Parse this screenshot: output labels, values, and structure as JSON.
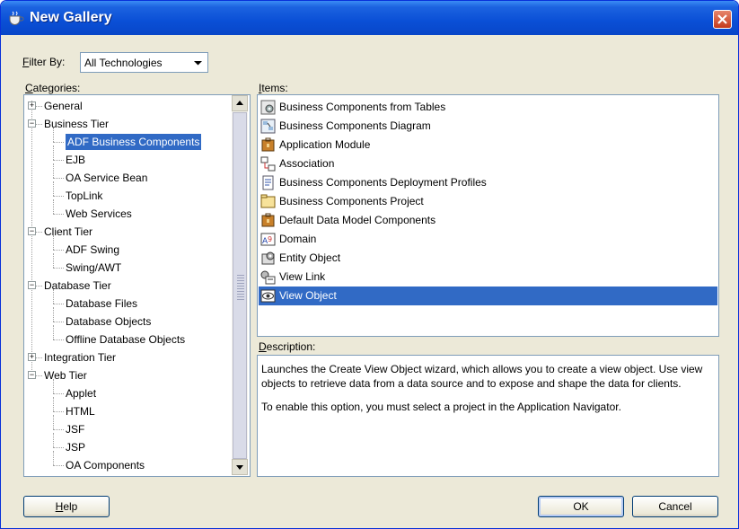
{
  "window": {
    "title": "New Gallery"
  },
  "filter": {
    "label_prefix": "F",
    "label_rest": "ilter By:",
    "value": "All Technologies"
  },
  "categories": {
    "label_prefix": "C",
    "label_rest": "ategories:",
    "tree": [
      {
        "label": "General",
        "level": 0,
        "expander": "plus"
      },
      {
        "label": "Business Tier",
        "level": 0,
        "expander": "minus"
      },
      {
        "label": "ADF Business Components",
        "level": 1,
        "selected": true
      },
      {
        "label": "EJB",
        "level": 1
      },
      {
        "label": "OA Service Bean",
        "level": 1
      },
      {
        "label": "TopLink",
        "level": 1
      },
      {
        "label": "Web Services",
        "level": 1
      },
      {
        "label": "Client Tier",
        "level": 0,
        "expander": "minus"
      },
      {
        "label": "ADF Swing",
        "level": 1
      },
      {
        "label": "Swing/AWT",
        "level": 1
      },
      {
        "label": "Database Tier",
        "level": 0,
        "expander": "minus"
      },
      {
        "label": "Database Files",
        "level": 1
      },
      {
        "label": "Database Objects",
        "level": 1
      },
      {
        "label": "Offline Database Objects",
        "level": 1
      },
      {
        "label": "Integration Tier",
        "level": 0,
        "expander": "plus"
      },
      {
        "label": "Web Tier",
        "level": 0,
        "expander": "minus"
      },
      {
        "label": "Applet",
        "level": 1
      },
      {
        "label": "HTML",
        "level": 1
      },
      {
        "label": "JSF",
        "level": 1
      },
      {
        "label": "JSP",
        "level": 1
      },
      {
        "label": "OA Components",
        "level": 1
      }
    ]
  },
  "items": {
    "label_prefix": "I",
    "label_rest": "tems:",
    "list": [
      {
        "label": "Business Components from Tables",
        "icon": "gear-table-icon"
      },
      {
        "label": "Business Components Diagram",
        "icon": "diagram-icon"
      },
      {
        "label": "Application Module",
        "icon": "module-icon"
      },
      {
        "label": "Association",
        "icon": "association-icon"
      },
      {
        "label": "Business Components Deployment Profiles",
        "icon": "deployment-profile-icon"
      },
      {
        "label": "Business Components Project",
        "icon": "project-icon"
      },
      {
        "label": "Default Data Model Components",
        "icon": "module-icon"
      },
      {
        "label": "Domain",
        "icon": "domain-icon"
      },
      {
        "label": "Entity Object",
        "icon": "entity-icon"
      },
      {
        "label": "View Link",
        "icon": "view-link-icon"
      },
      {
        "label": "View Object",
        "icon": "view-object-icon",
        "selected": true
      }
    ]
  },
  "description": {
    "label_prefix": "D",
    "label_rest": "escription:",
    "paragraphs": [
      "Launches the Create View Object wizard, which allows you to create a view object. Use view objects to retrieve data from a data source and to expose and shape the data for clients.",
      "To enable this option, you must select a project in the Application Navigator."
    ]
  },
  "buttons": {
    "help_prefix": "H",
    "help_rest": "elp",
    "ok": "OK",
    "cancel": "Cancel"
  },
  "colors": {
    "selection": "#316ac5",
    "titlebar": "#0a4fd6",
    "dialog_bg": "#ece9d8"
  }
}
